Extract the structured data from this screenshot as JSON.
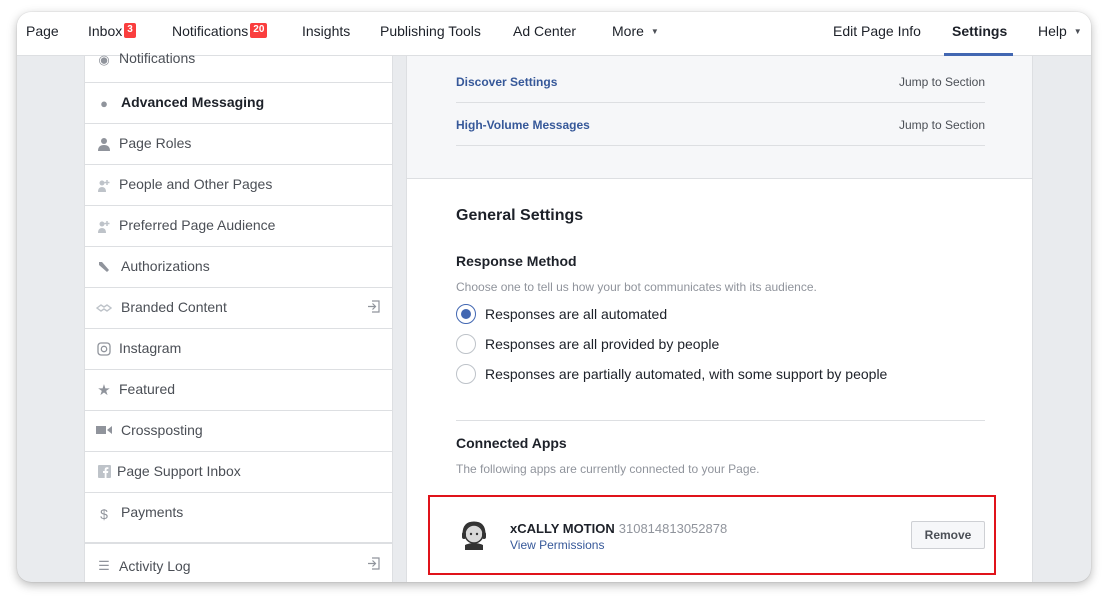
{
  "nav": {
    "page": "Page",
    "inbox": "Inbox",
    "inbox_badge": "3",
    "notifications": "Notifications",
    "notifications_badge": "20",
    "insights": "Insights",
    "publishing_tools": "Publishing Tools",
    "ad_center": "Ad Center",
    "more": "More",
    "edit_page_info": "Edit Page Info",
    "settings": "Settings",
    "help": "Help"
  },
  "sidebar": {
    "items": [
      {
        "label": "Notifications",
        "icon": "globe-icon"
      },
      {
        "label": "Advanced Messaging",
        "icon": "messenger-icon"
      },
      {
        "label": "Page Roles",
        "icon": "person-icon"
      },
      {
        "label": "People and Other Pages",
        "icon": "person-plus-icon"
      },
      {
        "label": "Preferred Page Audience",
        "icon": "person-plus-icon"
      },
      {
        "label": "Authorizations",
        "icon": "wrench-icon"
      },
      {
        "label": "Branded Content",
        "icon": "handshake-icon"
      },
      {
        "label": "Instagram",
        "icon": "instagram-icon"
      },
      {
        "label": "Featured",
        "icon": "star-icon"
      },
      {
        "label": "Crossposting",
        "icon": "video-camera-icon"
      },
      {
        "label": "Page Support Inbox",
        "icon": "facebook-icon"
      },
      {
        "label": "Payments",
        "icon": "dollar-icon"
      }
    ],
    "activity_log": "Activity Log"
  },
  "sections": [
    {
      "label": "Discover Settings",
      "jump": "Jump to Section"
    },
    {
      "label": "High-Volume Messages",
      "jump": "Jump to Section"
    }
  ],
  "general": {
    "title": "General Settings",
    "response_method": {
      "title": "Response Method",
      "description": "Choose one to tell us how your bot communicates with its audience.",
      "options": [
        {
          "label": "Responses are all automated",
          "checked": true
        },
        {
          "label": "Responses are all provided by people",
          "checked": false
        },
        {
          "label": "Responses are partially automated, with some support by people",
          "checked": false
        }
      ]
    },
    "connected_apps": {
      "title": "Connected Apps",
      "description": "The following apps are currently connected to your Page.",
      "app": {
        "name": "xCALLY MOTION",
        "id": "310814813052878",
        "permissions_link": "View Permissions",
        "remove": "Remove"
      }
    }
  },
  "colors": {
    "link": "#365899",
    "accent": "#4267b2",
    "highlight_box": "#e0131a",
    "badge": "#fa3e3e"
  }
}
